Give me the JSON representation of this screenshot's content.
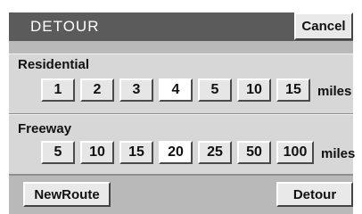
{
  "header": {
    "title": "DETOUR",
    "cancel_label": "Cancel"
  },
  "residential": {
    "label": "Residential",
    "options": [
      "1",
      "2",
      "3",
      "4",
      "5",
      "10",
      "15"
    ],
    "selected": "4",
    "units": "miles"
  },
  "freeway": {
    "label": "Freeway",
    "options": [
      "5",
      "10",
      "15",
      "20",
      "25",
      "50",
      "100"
    ],
    "selected": "20",
    "units": "miles"
  },
  "footer": {
    "newroute_label": "NewRoute",
    "detour_label": "Detour"
  },
  "colors": {
    "header_bg": "#5b5b5b",
    "panel_bg": "#d7d7d7",
    "button_bg": "#e6e6e6",
    "selected_bg": "#ffffff"
  }
}
